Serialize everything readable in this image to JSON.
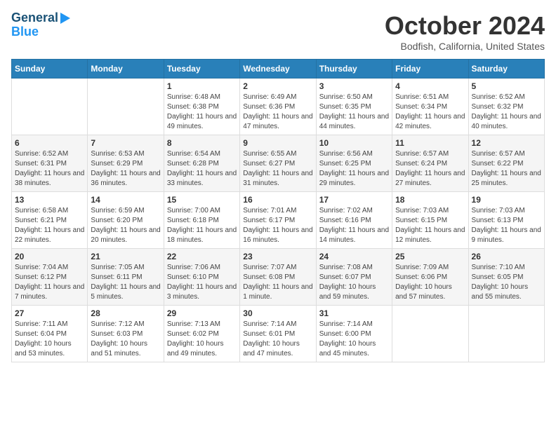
{
  "logo": {
    "general": "General",
    "blue": "Blue"
  },
  "title": "October 2024",
  "location": "Bodfish, California, United States",
  "weekdays": [
    "Sunday",
    "Monday",
    "Tuesday",
    "Wednesday",
    "Thursday",
    "Friday",
    "Saturday"
  ],
  "weeks": [
    [
      {
        "day": "",
        "info": ""
      },
      {
        "day": "",
        "info": ""
      },
      {
        "day": "1",
        "info": "Sunrise: 6:48 AM\nSunset: 6:38 PM\nDaylight: 11 hours and 49 minutes."
      },
      {
        "day": "2",
        "info": "Sunrise: 6:49 AM\nSunset: 6:36 PM\nDaylight: 11 hours and 47 minutes."
      },
      {
        "day": "3",
        "info": "Sunrise: 6:50 AM\nSunset: 6:35 PM\nDaylight: 11 hours and 44 minutes."
      },
      {
        "day": "4",
        "info": "Sunrise: 6:51 AM\nSunset: 6:34 PM\nDaylight: 11 hours and 42 minutes."
      },
      {
        "day": "5",
        "info": "Sunrise: 6:52 AM\nSunset: 6:32 PM\nDaylight: 11 hours and 40 minutes."
      }
    ],
    [
      {
        "day": "6",
        "info": "Sunrise: 6:52 AM\nSunset: 6:31 PM\nDaylight: 11 hours and 38 minutes."
      },
      {
        "day": "7",
        "info": "Sunrise: 6:53 AM\nSunset: 6:29 PM\nDaylight: 11 hours and 36 minutes."
      },
      {
        "day": "8",
        "info": "Sunrise: 6:54 AM\nSunset: 6:28 PM\nDaylight: 11 hours and 33 minutes."
      },
      {
        "day": "9",
        "info": "Sunrise: 6:55 AM\nSunset: 6:27 PM\nDaylight: 11 hours and 31 minutes."
      },
      {
        "day": "10",
        "info": "Sunrise: 6:56 AM\nSunset: 6:25 PM\nDaylight: 11 hours and 29 minutes."
      },
      {
        "day": "11",
        "info": "Sunrise: 6:57 AM\nSunset: 6:24 PM\nDaylight: 11 hours and 27 minutes."
      },
      {
        "day": "12",
        "info": "Sunrise: 6:57 AM\nSunset: 6:22 PM\nDaylight: 11 hours and 25 minutes."
      }
    ],
    [
      {
        "day": "13",
        "info": "Sunrise: 6:58 AM\nSunset: 6:21 PM\nDaylight: 11 hours and 22 minutes."
      },
      {
        "day": "14",
        "info": "Sunrise: 6:59 AM\nSunset: 6:20 PM\nDaylight: 11 hours and 20 minutes."
      },
      {
        "day": "15",
        "info": "Sunrise: 7:00 AM\nSunset: 6:18 PM\nDaylight: 11 hours and 18 minutes."
      },
      {
        "day": "16",
        "info": "Sunrise: 7:01 AM\nSunset: 6:17 PM\nDaylight: 11 hours and 16 minutes."
      },
      {
        "day": "17",
        "info": "Sunrise: 7:02 AM\nSunset: 6:16 PM\nDaylight: 11 hours and 14 minutes."
      },
      {
        "day": "18",
        "info": "Sunrise: 7:03 AM\nSunset: 6:15 PM\nDaylight: 11 hours and 12 minutes."
      },
      {
        "day": "19",
        "info": "Sunrise: 7:03 AM\nSunset: 6:13 PM\nDaylight: 11 hours and 9 minutes."
      }
    ],
    [
      {
        "day": "20",
        "info": "Sunrise: 7:04 AM\nSunset: 6:12 PM\nDaylight: 11 hours and 7 minutes."
      },
      {
        "day": "21",
        "info": "Sunrise: 7:05 AM\nSunset: 6:11 PM\nDaylight: 11 hours and 5 minutes."
      },
      {
        "day": "22",
        "info": "Sunrise: 7:06 AM\nSunset: 6:10 PM\nDaylight: 11 hours and 3 minutes."
      },
      {
        "day": "23",
        "info": "Sunrise: 7:07 AM\nSunset: 6:08 PM\nDaylight: 11 hours and 1 minute."
      },
      {
        "day": "24",
        "info": "Sunrise: 7:08 AM\nSunset: 6:07 PM\nDaylight: 10 hours and 59 minutes."
      },
      {
        "day": "25",
        "info": "Sunrise: 7:09 AM\nSunset: 6:06 PM\nDaylight: 10 hours and 57 minutes."
      },
      {
        "day": "26",
        "info": "Sunrise: 7:10 AM\nSunset: 6:05 PM\nDaylight: 10 hours and 55 minutes."
      }
    ],
    [
      {
        "day": "27",
        "info": "Sunrise: 7:11 AM\nSunset: 6:04 PM\nDaylight: 10 hours and 53 minutes."
      },
      {
        "day": "28",
        "info": "Sunrise: 7:12 AM\nSunset: 6:03 PM\nDaylight: 10 hours and 51 minutes."
      },
      {
        "day": "29",
        "info": "Sunrise: 7:13 AM\nSunset: 6:02 PM\nDaylight: 10 hours and 49 minutes."
      },
      {
        "day": "30",
        "info": "Sunrise: 7:14 AM\nSunset: 6:01 PM\nDaylight: 10 hours and 47 minutes."
      },
      {
        "day": "31",
        "info": "Sunrise: 7:14 AM\nSunset: 6:00 PM\nDaylight: 10 hours and 45 minutes."
      },
      {
        "day": "",
        "info": ""
      },
      {
        "day": "",
        "info": ""
      }
    ]
  ]
}
